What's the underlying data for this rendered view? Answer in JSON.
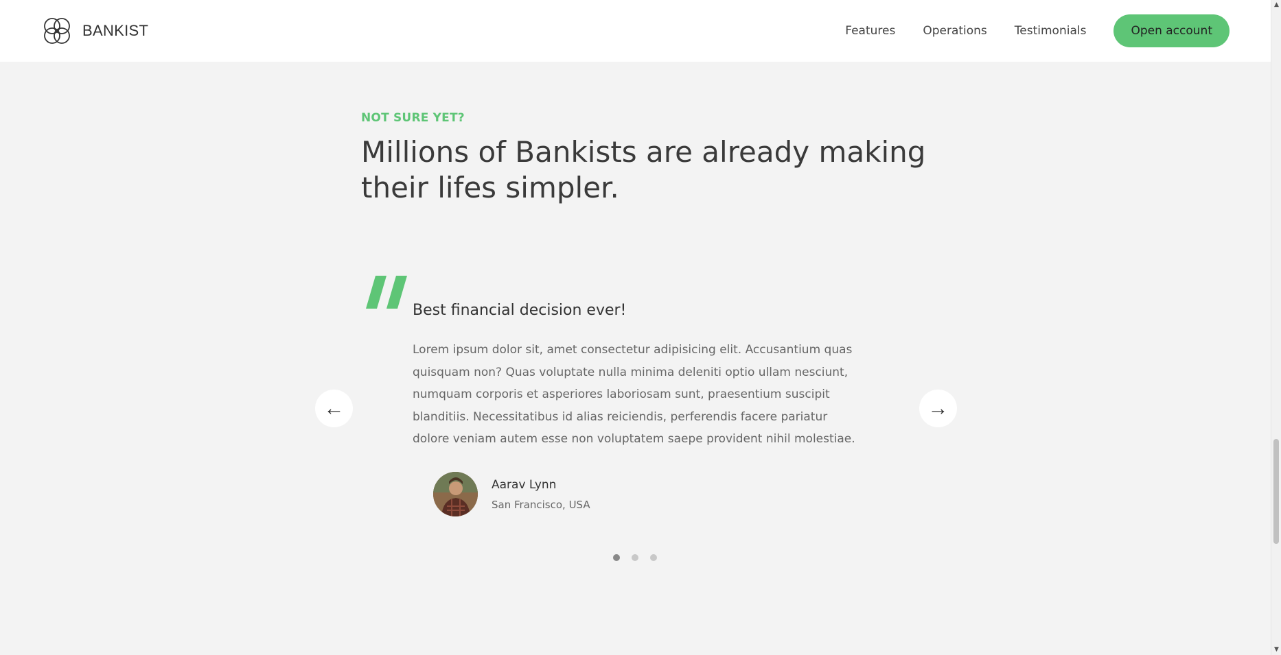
{
  "nav": {
    "brand": "BANKIST",
    "links": [
      "Features",
      "Operations",
      "Testimonials"
    ],
    "cta": "Open account"
  },
  "section": {
    "subtitle": "NOT SURE YET?",
    "title": "Millions of Bankists are already making their lifes simpler."
  },
  "testimonial": {
    "header": "Best financial decision ever!",
    "text": "Lorem ipsum dolor sit, amet consectetur adipisicing elit. Accusantium quas quisquam non? Quas voluptate nulla minima deleniti optio ullam nesciunt, numquam corporis et asperiores laboriosam sunt, praesentium suscipit blanditiis. Necessitatibus id alias reiciendis, perferendis facere pariatur dolore veniam autem esse non voluptatem saepe provident nihil molestiae.",
    "author_name": "Aarav Lynn",
    "author_location": "San Francisco, USA"
  },
  "slider": {
    "left_arrow": "←",
    "right_arrow": "→",
    "dots_count": 3,
    "active_dot": 0
  },
  "icons": {
    "logo": "logo-icon",
    "quote": "quote-icon",
    "left": "arrow-left-icon",
    "right": "arrow-right-icon"
  },
  "colors": {
    "accent": "#5ec576",
    "background": "#f3f3f3",
    "nav_bg": "#ffffff"
  }
}
